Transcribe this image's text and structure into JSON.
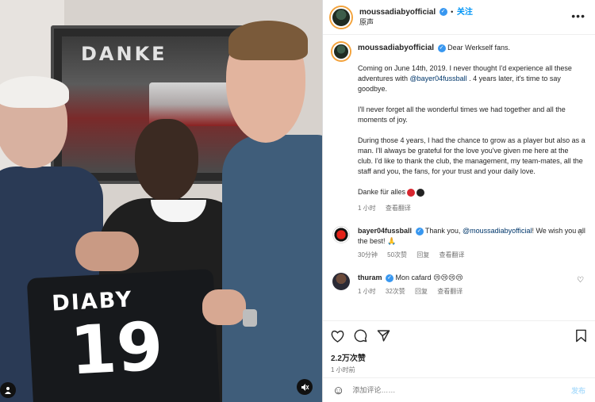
{
  "media": {
    "sign_text": "DANKE",
    "jersey_name": "DIABY",
    "jersey_number": "19",
    "user_icon": "person-icon",
    "mute_icon": "speaker-muted-icon"
  },
  "header": {
    "username": "moussadiabyofficial",
    "separator": "•",
    "follow_label": "关注",
    "audio_label": "原声",
    "more_icon": "more-horizontal-icon"
  },
  "caption": {
    "username": "moussadiabyofficial",
    "greeting": "Dear Werkself fans.",
    "para1_a": "Coming on June 14th, 2019. I never thought I'd experience all these adventures with ",
    "para1_mention": "@bayer04fussball",
    "para1_b": " . 4 years later, it's time to say goodbye.",
    "para2": "I'll never forget all the wonderful times we had together and all the moments of joy.",
    "para3": "During those 4 years, I had the chance to grow as a player but also as a man. I'll always be grateful for the love you've given me here at the club. I'd like to thank the club, the management, my team-mates, all the staff and you, the fans, for your trust and your daily love.",
    "para4": "Danke für alles",
    "time": "1 小时",
    "translate": "查看翻译"
  },
  "comments": [
    {
      "username": "bayer04fussball",
      "text_a": "Thank you, ",
      "mention": "@moussadiabyofficial",
      "text_b": "! We wish you all the best! 🙏",
      "time": "30分钟",
      "likes": "50次赞",
      "reply": "回复",
      "translate": "查看翻译"
    },
    {
      "username": "thuram",
      "text": "Mon cafard 😢😢😢😢",
      "time": "1 小时",
      "likes": "32次赞",
      "reply": "回复",
      "translate": "查看翻译"
    }
  ],
  "actions": {
    "like_icon": "heart-icon",
    "comment_icon": "comment-icon",
    "share_icon": "send-icon",
    "save_icon": "bookmark-icon",
    "likes_count": "2.2万次赞",
    "post_time": "1 小时前"
  },
  "add_comment": {
    "placeholder": "添加评论……",
    "post_label": "发布"
  },
  "colors": {
    "accent": "#0095f6",
    "mention": "#00376b",
    "story_ring": "#f3a23b"
  }
}
